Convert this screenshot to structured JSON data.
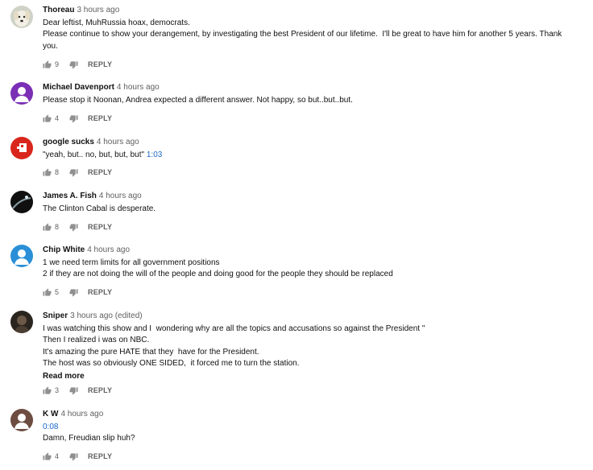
{
  "comments": [
    {
      "author": "Thoreau",
      "time": "3 hours ago",
      "lines": [
        "Dear leftist, MuhRussia hoax, democrats.",
        "Please continue to show your derangement, by investigating the best President of our lifetime.  I'll be great to have him for another 5 years. Thank",
        "you."
      ],
      "likes": "9",
      "reply_label": "REPLY",
      "avatar_icon": "dog-avatar"
    },
    {
      "author": "Michael Davenport",
      "time": "4 hours ago",
      "lines": [
        "Please stop it Noonan, Andrea expected a different answer. Not happy, so but..but..but."
      ],
      "likes": "4",
      "reply_label": "REPLY",
      "avatar_icon": "default-person-avatar",
      "avatar_color": "#7b2fb5"
    },
    {
      "author": "google sucks",
      "time": "4 hours ago",
      "line_prefix": "\"yeah, but.. no, but, but, but\" ",
      "timestamp_link": "1:03",
      "likes": "8",
      "reply_label": "REPLY",
      "avatar_icon": "red-flag-avatar"
    },
    {
      "author": "James A. Fish",
      "time": "4 hours ago",
      "lines": [
        "The Clinton Cabal is desperate."
      ],
      "likes": "8",
      "reply_label": "REPLY",
      "avatar_icon": "dark-photo-avatar"
    },
    {
      "author": "Chip White",
      "time": "4 hours ago",
      "lines": [
        "1 we need term limits for all government positions",
        "2 if they are not doing the will of the people and doing good for the people they should be replaced"
      ],
      "likes": "5",
      "reply_label": "REPLY",
      "avatar_icon": "default-person-avatar",
      "avatar_color": "#2a8fd6"
    },
    {
      "author": "Sniper",
      "time": "3 hours ago (edited)",
      "lines": [
        "I was watching this show and I  wondering why are all the topics and accusations so against the President \"",
        "Then I realized i was on NBC.",
        "It's amazing the pure HATE that they  have for the President.",
        "The host was so obviously ONE SIDED,  it forced me to turn the station."
      ],
      "read_more": "Read more",
      "likes": "3",
      "reply_label": "REPLY",
      "avatar_icon": "dark-photo-avatar"
    },
    {
      "author": "K W",
      "time": "4 hours ago",
      "timestamp_link": "0:08",
      "lines": [
        "Damn, Freudian slip huh?"
      ],
      "likes": "4",
      "reply_label": "REPLY",
      "avatar_icon": "default-person-avatar",
      "avatar_color": "#6d4c41"
    }
  ],
  "icons": {
    "like": "thumbs-up-icon",
    "dislike": "thumbs-down-icon"
  }
}
